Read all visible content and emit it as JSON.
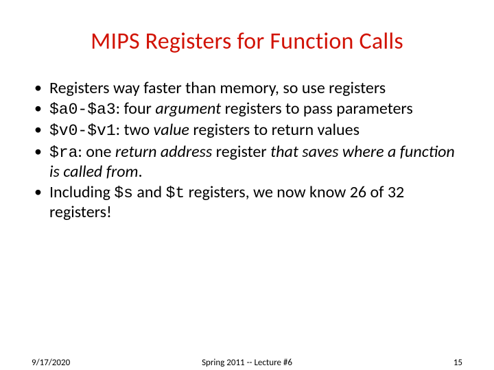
{
  "title": "MIPS Registers for Function Calls",
  "bullets": {
    "b1": "Registers way faster than memory, so use registers",
    "b2": {
      "code": "$a0-$a3",
      "mid": ": four ",
      "em": "argument",
      "tail": " registers to pass parameters"
    },
    "b3": {
      "code": "$v0-$v1",
      "mid": ": two ",
      "em": "value",
      "tail": " registers to return values"
    },
    "b4": {
      "code": "$ra",
      "mid": ": one ",
      "em": "return address",
      "mid2": " register ",
      "em2": "that saves where a function is called from",
      "tail": "."
    },
    "b5": {
      "pre": "Including ",
      "code1": "$s",
      "mid": " and ",
      "code2": "$t",
      "tail": " registers, we now know 26 of 32 registers!"
    }
  },
  "footer": {
    "date": "9/17/2020",
    "course": "Spring 2011 -- Lecture #6",
    "page": "15"
  }
}
